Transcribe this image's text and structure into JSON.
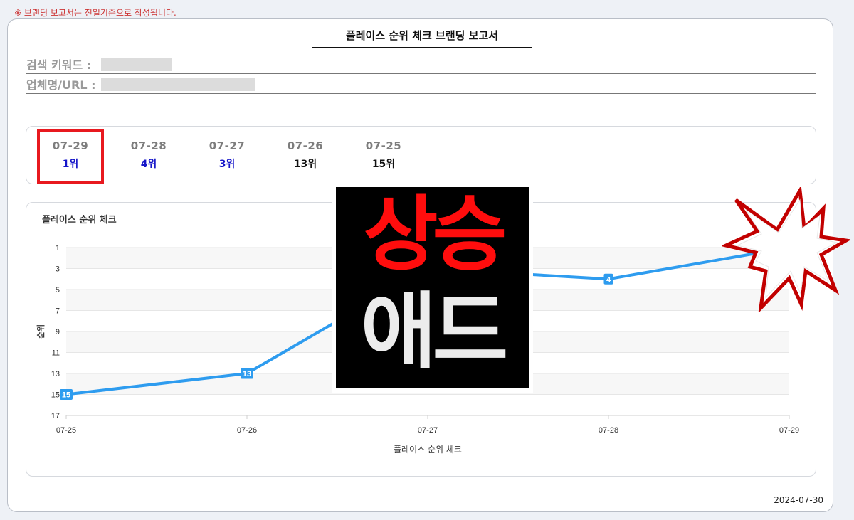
{
  "notice": "※ 브랜딩 보고서는 전일기준으로 작성됩니다.",
  "report": {
    "title": "플레이스 순위 체크 브랜딩 보고서",
    "keyword_label": "검색 키워드 :",
    "company_label": "업체명/URL :",
    "date": "2024-07-30"
  },
  "tabs": [
    {
      "date": "07-29",
      "rank": "1위",
      "color": "#1515c9"
    },
    {
      "date": "07-28",
      "rank": "4위",
      "color": "#1515c9"
    },
    {
      "date": "07-27",
      "rank": "3위",
      "color": "#1515c9"
    },
    {
      "date": "07-26",
      "rank": "13위",
      "color": "#111111"
    },
    {
      "date": "07-25",
      "rank": "15위",
      "color": "#111111"
    }
  ],
  "overlay": {
    "line1": "상승",
    "line2": "애드"
  },
  "colors": {
    "line": "#2e9cef",
    "selected": "#e8191f"
  },
  "chart_data": {
    "type": "line",
    "title": "플레이스 순위 체크",
    "xlabel": "플레이스 순위 체크",
    "ylabel": "순위",
    "categories": [
      "07-25",
      "07-26",
      "07-27",
      "07-28",
      "07-29"
    ],
    "series": [
      {
        "values": [
          15,
          13,
          3,
          4,
          1
        ]
      }
    ],
    "y_ticks": [
      1,
      3,
      5,
      7,
      9,
      11,
      13,
      15,
      17
    ],
    "ylim": [
      1,
      17
    ],
    "y_reversed": true,
    "grid": true,
    "data_labels": true
  }
}
